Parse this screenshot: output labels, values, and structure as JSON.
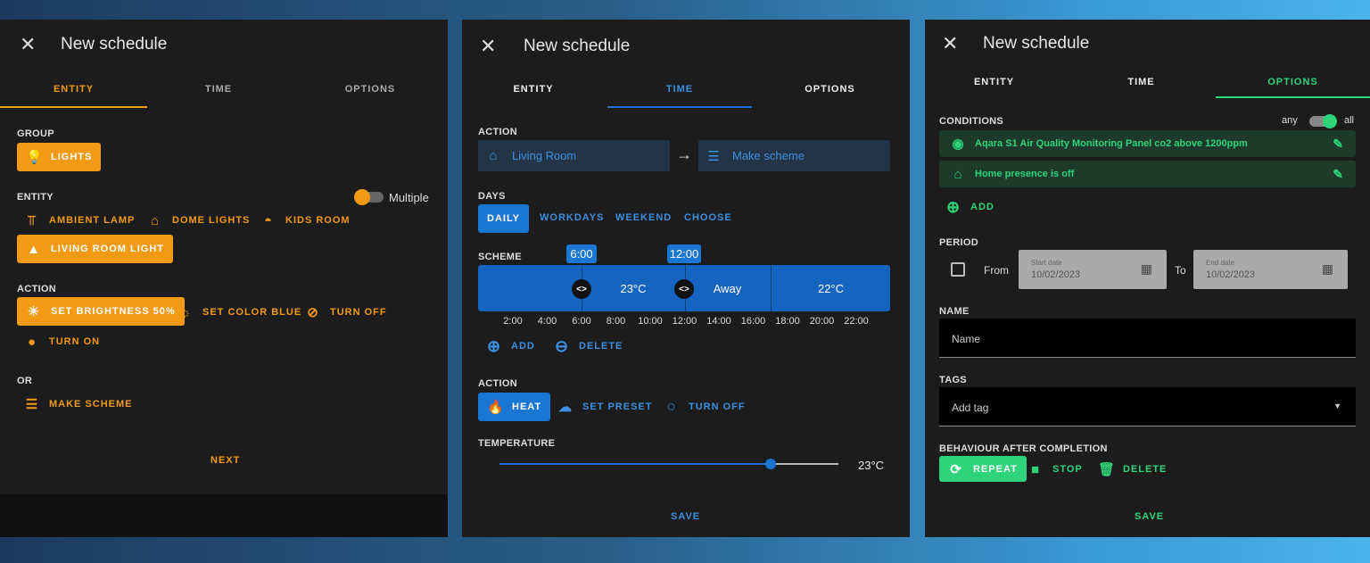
{
  "panel1": {
    "title": "New schedule",
    "tabs": {
      "entity": "ENTITY",
      "time": "TIME",
      "options": "OPTIONS"
    },
    "group_label": "GROUP",
    "group_btn": "LIGHTS",
    "entity_label": "ENTITY",
    "multiple_label": "Multiple",
    "entities": [
      "AMBIENT LAMP",
      "DOME LIGHTS",
      "KIDS ROOM",
      "LIVING ROOM LIGHT"
    ],
    "action_label": "ACTION",
    "actions": [
      "SET BRIGHTNESS 50%",
      "SET COLOR BLUE",
      "TURN OFF",
      "TURN ON"
    ],
    "or_label": "OR",
    "make_scheme": "MAKE SCHEME",
    "next": "NEXT",
    "accent": "#f39a14"
  },
  "panel2": {
    "title": "New schedule",
    "tabs": {
      "entity": "ENTITY",
      "time": "TIME",
      "options": "OPTIONS"
    },
    "action_label": "ACTION",
    "field_left": "Living Room",
    "field_right": "Make scheme",
    "days_label": "DAYS",
    "days": [
      "DAILY",
      "WORKDAYS",
      "WEEKEND",
      "CHOOSE"
    ],
    "scheme_label": "SCHEME",
    "pins": [
      "6:00",
      "12:00"
    ],
    "segments": [
      "23°C",
      "Away",
      "22°C"
    ],
    "ticks": [
      "2:00",
      "4:00",
      "6:00",
      "8:00",
      "10:00",
      "12:00",
      "14:00",
      "16:00",
      "18:00",
      "20:00",
      "22:00"
    ],
    "add": "ADD",
    "delete": "DELETE",
    "action2_label": "ACTION",
    "action2": [
      "HEAT",
      "SET PRESET",
      "TURN OFF"
    ],
    "temperature_label": "TEMPERATURE",
    "temperature_value": "23°C",
    "slider_fraction": 0.8,
    "save": "SAVE",
    "accent": "#1976d2"
  },
  "panel3": {
    "title": "New schedule",
    "tabs": {
      "entity": "ENTITY",
      "time": "TIME",
      "options": "OPTIONS"
    },
    "conditions_label": "CONDITIONS",
    "any": "any",
    "all": "all",
    "conditions": [
      "Aqara S1 Air Quality Monitoring Panel co2 above 1200ppm",
      "Home presence is off"
    ],
    "add": "ADD",
    "period_label": "PERIOD",
    "from": "From",
    "to": "To",
    "start_label": "Start date",
    "start_value": "10/02/2023",
    "end_label": "End date",
    "end_value": "10/02/2023",
    "name_label": "NAME",
    "name_placeholder": "Name",
    "tags_label": "TAGS",
    "tags_placeholder": "Add tag",
    "behaviour_label": "BEHAVIOUR AFTER COMPLETION",
    "behaviour": [
      "REPEAT",
      "STOP",
      "DELETE"
    ],
    "save": "SAVE",
    "accent": "#2ed47a"
  }
}
